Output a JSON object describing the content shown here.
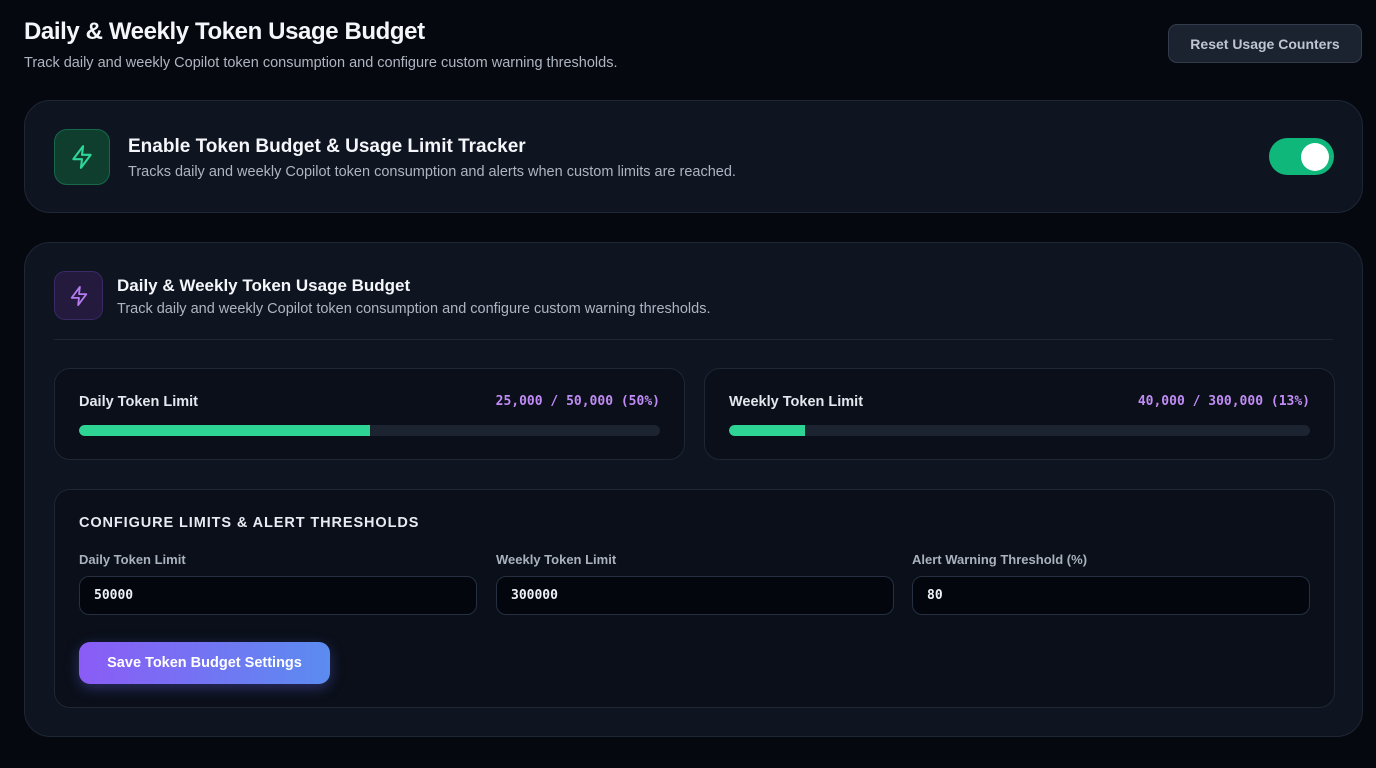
{
  "header": {
    "title": "Daily & Weekly Token Usage Budget",
    "subtitle": "Track daily and weekly Copilot token consumption and configure custom warning thresholds.",
    "reset_button": "Reset Usage Counters"
  },
  "enable_card": {
    "icon": "lightning-bolt-icon",
    "title": "Enable Token Budget & Usage Limit Tracker",
    "description": "Tracks daily and weekly Copilot token consumption and alerts when custom limits are reached.",
    "toggle_on": true
  },
  "budget_card": {
    "icon": "lightning-bolt-icon",
    "title": "Daily & Weekly Token Usage Budget",
    "subtitle": "Track daily and weekly Copilot token consumption and configure custom warning thresholds."
  },
  "usage": {
    "daily": {
      "label": "Daily Token Limit",
      "value_text": "25,000 / 50,000 (50%)",
      "progress": 0.5
    },
    "weekly": {
      "label": "Weekly Token Limit",
      "value_text": "40,000 / 300,000 (13%)",
      "progress": 0.13
    }
  },
  "config": {
    "title": "CONFIGURE LIMITS & ALERT THRESHOLDS",
    "daily_label": "Daily Token Limit",
    "daily_value": "50000",
    "weekly_label": "Weekly Token Limit",
    "weekly_value": "300000",
    "threshold_label": "Alert Warning Threshold (%)",
    "threshold_value": "80",
    "save_button": "Save Token Budget Settings"
  },
  "colors": {
    "accent_green": "#10b77a",
    "progress_green": "#2dd493",
    "usage_value_purple": "#c18cf5",
    "save_gradient_start": "#8b5cf6",
    "save_gradient_end": "#5b8cf0"
  }
}
